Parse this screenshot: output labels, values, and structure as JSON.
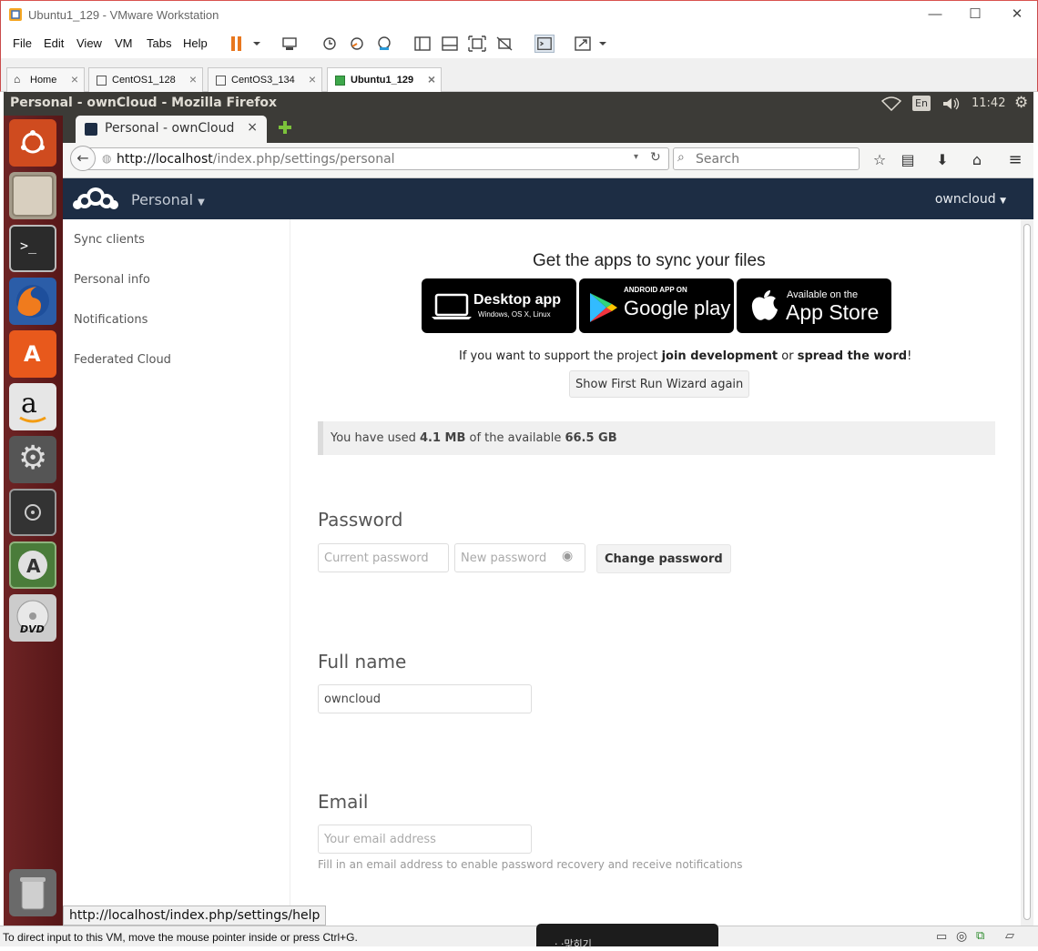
{
  "vmware": {
    "title": "Ubuntu1_129 - VMware Workstation",
    "menu": [
      "File",
      "Edit",
      "View",
      "VM",
      "Tabs",
      "Help"
    ],
    "tabs": [
      {
        "label": "Home"
      },
      {
        "label": "CentOS1_128"
      },
      {
        "label": "CentOS3_134"
      },
      {
        "label": "Ubuntu1_129"
      }
    ],
    "status_text": "To direct input to this VM, move the mouse pointer inside or press Ctrl+G.",
    "ime_text": "· ·맞히기"
  },
  "ubuntu": {
    "window_title": "Personal - ownCloud - Mozilla Firefox",
    "keyboard": "En",
    "clock": "11:42"
  },
  "firefox": {
    "tab_title": "Personal - ownCloud",
    "url_host": "http://localhost",
    "url_path": "/index.php/settings/personal",
    "search_placeholder": "Search",
    "status_url": "http://localhost/index.php/settings/help"
  },
  "owncloud": {
    "app_name": "Personal",
    "user": "owncloud",
    "sidebar": [
      "Sync clients",
      "Personal info",
      "Notifications",
      "Federated Cloud"
    ],
    "apps_heading": "Get the apps to sync your files",
    "badges": {
      "desktop_title": "Desktop app",
      "desktop_sub": "Windows, OS X, Linux",
      "android_top": "ANDROID APP ON",
      "android_main": "Google play",
      "ios_top": "Available on the",
      "ios_main": "App Store"
    },
    "support": {
      "p1": "If you want to support the project ",
      "link1": "join development",
      "p2": " or ",
      "link2": "spread the word",
      "p3": "!"
    },
    "wizard_button": "Show First Run Wizard again",
    "quota": {
      "p1": "You have used ",
      "used": "4.1 MB",
      "p2": " of the available ",
      "total": "66.5 GB"
    },
    "password": {
      "title": "Password",
      "current_placeholder": "Current password",
      "new_placeholder": "New password",
      "button": "Change password"
    },
    "fullname": {
      "title": "Full name",
      "value": "owncloud"
    },
    "email": {
      "title": "Email",
      "placeholder": "Your email address",
      "hint": "Fill in an email address to enable password recovery and receive notifications"
    }
  },
  "colors": {
    "oc_header": "#1d2d44",
    "launcher": "#5a1a1b",
    "ubuntu_panel": "#3c3b37"
  }
}
